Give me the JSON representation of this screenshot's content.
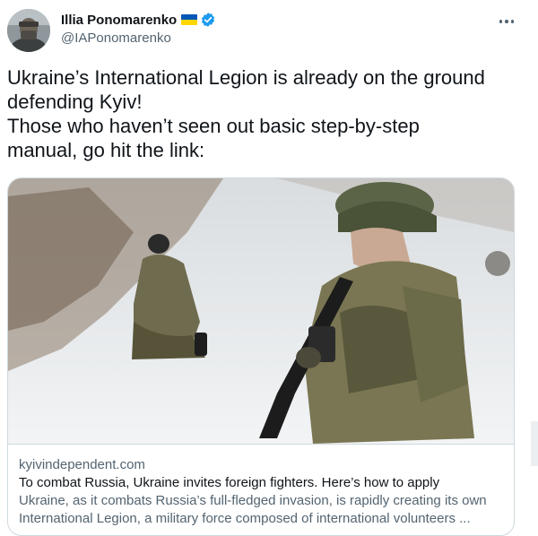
{
  "author": {
    "display_name": "Illia Ponomarenko",
    "handle": "@IAPonomarenko"
  },
  "tweet": {
    "lines": [
      "Ukraine’s International Legion is already on the ground",
      "defending Kyiv!",
      "Those who haven’t seen out basic step-by-step",
      "manual, go hit the link:"
    ]
  },
  "card": {
    "domain": "kyivindependent.com",
    "title": "To combat Russia, Ukraine invites foreign fighters. Here’s how to apply",
    "description_lines": [
      "Ukraine, as it combats Russia’s full-fledged invasion, is rapidly creating its own",
      "International Legion, a military force composed of international volunteers ..."
    ]
  },
  "colors": {
    "text_primary": "#0f1419",
    "text_secondary": "#536471",
    "border": "#cfd9de",
    "verified": "#1d9bf0",
    "flag_blue": "#0057b7",
    "flag_yellow": "#ffd700"
  },
  "icons": {
    "more": "more-horizontal-icon",
    "verified": "verified-badge-icon",
    "flag": "ukraine-flag-icon"
  }
}
